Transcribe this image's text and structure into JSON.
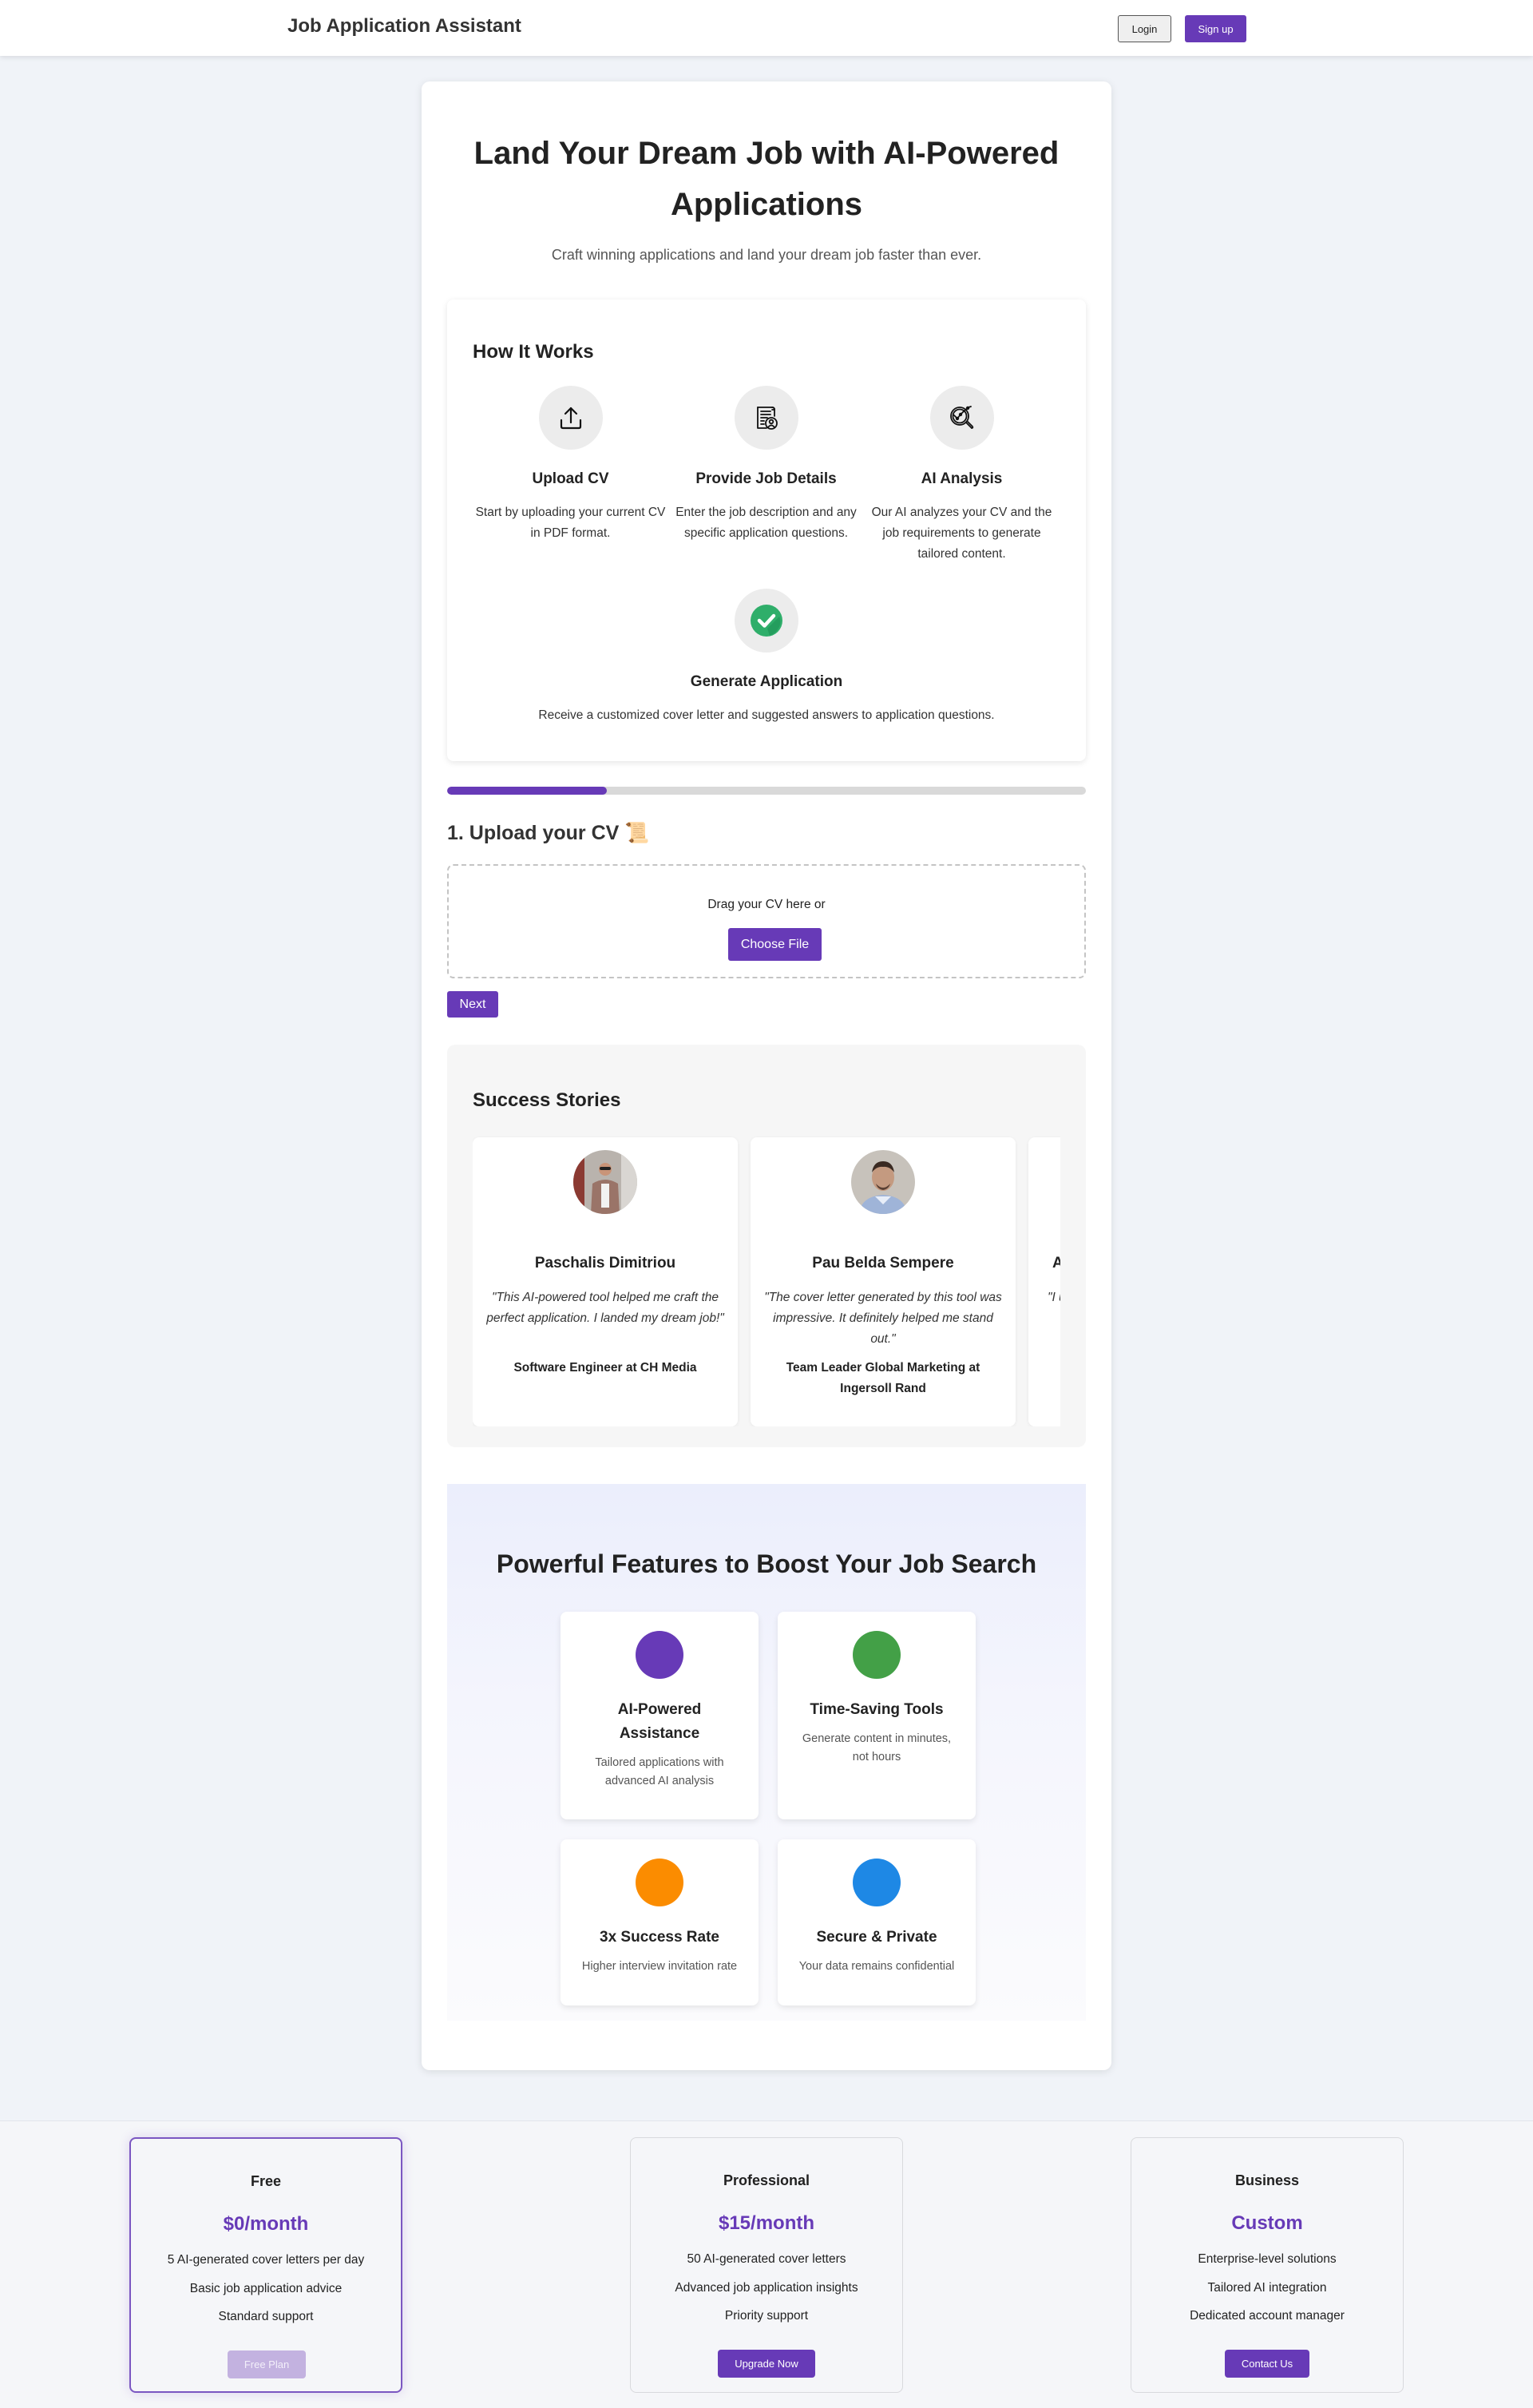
{
  "header": {
    "brand": "Job Application Assistant",
    "login_label": "Login",
    "signup_label": "Sign up"
  },
  "hero": {
    "title": "Land Your Dream Job with AI-Powered Applications",
    "subtitle": "Craft winning applications and land your dream job faster than ever."
  },
  "how_it_works": {
    "title": "How It Works",
    "steps": [
      {
        "icon": "upload-icon",
        "title": "Upload CV",
        "description": "Start by uploading your current CV in PDF format."
      },
      {
        "icon": "job-document-icon",
        "title": "Provide Job Details",
        "description": "Enter the job description and any specific application questions."
      },
      {
        "icon": "analysis-magnifier-icon",
        "title": "AI Analysis",
        "description": "Our AI analyzes your CV and the job requirements to generate tailored content."
      },
      {
        "icon": "check-circle-icon",
        "title": "Generate Application",
        "description": "Receive a customized cover letter and suggested answers to application questions."
      }
    ]
  },
  "wizard": {
    "progress_percent": 25,
    "step_title": "1. Upload your CV",
    "step_emoji": "📜",
    "drop_text": "Drag your CV here or",
    "choose_file_label": "Choose File",
    "next_label": "Next"
  },
  "success_stories": {
    "title": "Success Stories",
    "stories": [
      {
        "name": "Paschalis Dimitriou",
        "quote": "\"This AI-powered tool helped me craft the perfect application. I landed my dream job!\"",
        "role": "Software Engineer at CH Media"
      },
      {
        "name": "Pau Belda Sempere",
        "quote": "\"The cover letter generated by this tool was impressive. It definitely helped me stand out.\"",
        "role": "Team Leader Global Marketing at Ingersoll Rand"
      },
      {
        "name": "A",
        "quote": "\"I un",
        "role": ""
      }
    ]
  },
  "features": {
    "title": "Powerful Features to Boost Your Job Search",
    "items": [
      {
        "title": "AI-Powered Assistance",
        "description": "Tailored applications with advanced AI analysis",
        "color": "#673ab7"
      },
      {
        "title": "Time-Saving Tools",
        "description": "Generate content in minutes, not hours",
        "color": "#43a047"
      },
      {
        "title": "3x Success Rate",
        "description": "Higher interview invitation rate",
        "color": "#fb8c00"
      },
      {
        "title": "Secure & Private",
        "description": "Your data remains confidential",
        "color": "#1e88e5"
      }
    ]
  },
  "pricing": {
    "plans": [
      {
        "name": "Free",
        "price": "$0/month",
        "features": [
          "5 AI-generated cover letters per day",
          "Basic job application advice",
          "Standard support"
        ],
        "button": "Free Plan",
        "current": true
      },
      {
        "name": "Professional",
        "price": "$15/month",
        "features": [
          "50 AI-generated cover letters",
          "Advanced job application insights",
          "Priority support"
        ],
        "button": "Upgrade Now",
        "current": false
      },
      {
        "name": "Business",
        "price": "Custom",
        "features": [
          "Enterprise-level solutions",
          "Tailored AI integration",
          "Dedicated account manager"
        ],
        "button": "Contact Us",
        "current": false
      }
    ]
  },
  "colors": {
    "accent": "#673ab7",
    "page_bg": "#f0f3f8",
    "check_green": "#2fae6a"
  }
}
